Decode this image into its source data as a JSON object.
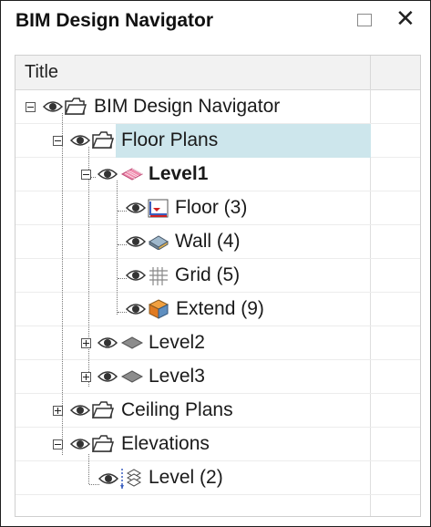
{
  "window": {
    "title": "BIM Design Navigator",
    "controls": {
      "maximize_icon": "maximize-icon",
      "close_symbol": "✕"
    }
  },
  "tree": {
    "column_header": "Title",
    "selection_color": "#cde6ec",
    "items": [
      {
        "label": "BIM Design Navigator",
        "icon": "folder-icon",
        "expander": "minus"
      },
      {
        "label": "Floor Plans",
        "icon": "folder-icon",
        "expander": "minus",
        "selected": true
      },
      {
        "label": "Level1",
        "icon": "level-plane-icon",
        "expander": "minus",
        "bold": true
      },
      {
        "label": "Floor (3)",
        "icon": "floor-icon"
      },
      {
        "label": "Wall (4)",
        "icon": "wall-icon"
      },
      {
        "label": "Grid (5)",
        "icon": "grid-icon"
      },
      {
        "label": "Extend (9)",
        "icon": "extend-icon"
      },
      {
        "label": "Level2",
        "icon": "level-plane-icon",
        "expander": "plus"
      },
      {
        "label": "Level3",
        "icon": "level-plane-icon",
        "expander": "plus"
      },
      {
        "label": "Ceiling Plans",
        "icon": "folder-icon",
        "expander": "plus"
      },
      {
        "label": "Elevations",
        "icon": "folder-icon",
        "expander": "minus"
      },
      {
        "label": "Level (2)",
        "icon": "elevation-level-icon"
      }
    ]
  }
}
